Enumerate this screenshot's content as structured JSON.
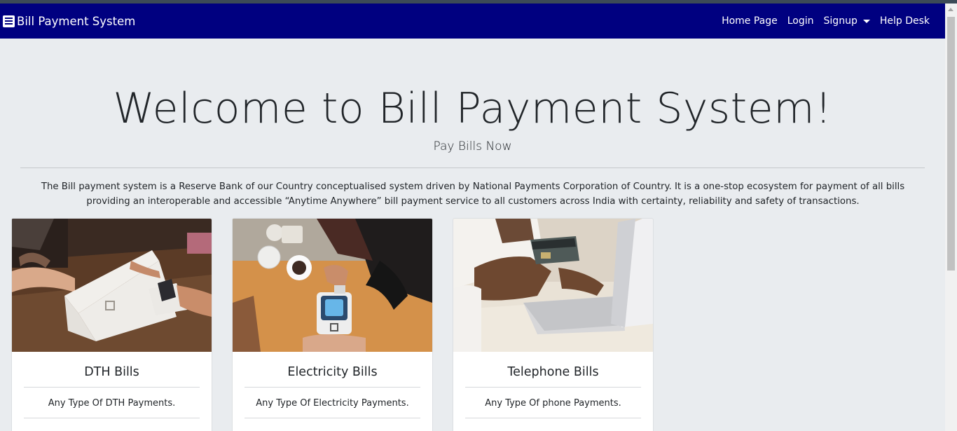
{
  "navbar": {
    "brand": "Bill Payment System",
    "brand_icon": "menu-list-icon",
    "links": [
      {
        "label": "Home Page"
      },
      {
        "label": "Login"
      },
      {
        "label": "Signup"
      },
      {
        "label": "Help Desk"
      }
    ],
    "bg_color": "#000080"
  },
  "hero": {
    "title": "Welcome to Bill Payment System!",
    "subtitle": "Pay Bills Now",
    "description": "The Bill payment system is a Reserve Bank of our Country conceptualised system driven by National Payments Corporation of Country. It is a one-stop ecosystem for payment of all bills providing an interoperable and accessible “Anytime Anywhere” bill payment service to all customers across India with certainty, reliability and safety of transactions."
  },
  "cards": [
    {
      "title": "DTH Bills",
      "text": "Any Type Of DTH Payments.",
      "image": "card-terminal-payment-photo"
    },
    {
      "title": "Electricity Bills",
      "text": "Any Type Of Electricity Payments.",
      "image": "contactless-card-reader-photo"
    },
    {
      "title": "Telephone Bills",
      "text": "Any Type Of phone Payments.",
      "image": "laptop-online-payment-photo"
    }
  ]
}
